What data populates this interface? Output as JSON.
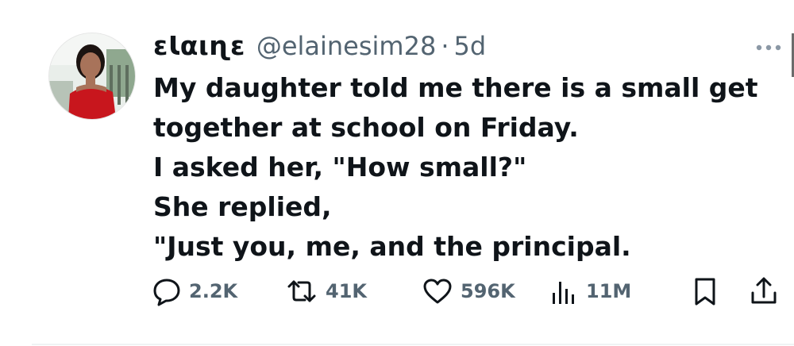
{
  "author": {
    "display_name": "ɛƖαιɳɛ",
    "handle": "@elainesim28",
    "separator": "·",
    "time": "5d"
  },
  "tweet": {
    "lines": [
      "My daughter told me there is a small get",
      "together at school on Friday.",
      "I asked her, \"How small?\"",
      "She replied,",
      "\"Just you, me, and the principal."
    ]
  },
  "actions": {
    "replies": "2.2K",
    "retweets": "41K",
    "likes": "596K",
    "views": "11M"
  },
  "colors": {
    "text": "#0f1419",
    "secondary": "#536471",
    "avatar_dress": "#c8161d"
  },
  "icons": {
    "more": "more-icon",
    "reply": "reply-icon",
    "retweet": "retweet-icon",
    "like": "heart-icon",
    "views": "views-icon",
    "bookmark": "bookmark-icon",
    "share": "share-icon"
  }
}
